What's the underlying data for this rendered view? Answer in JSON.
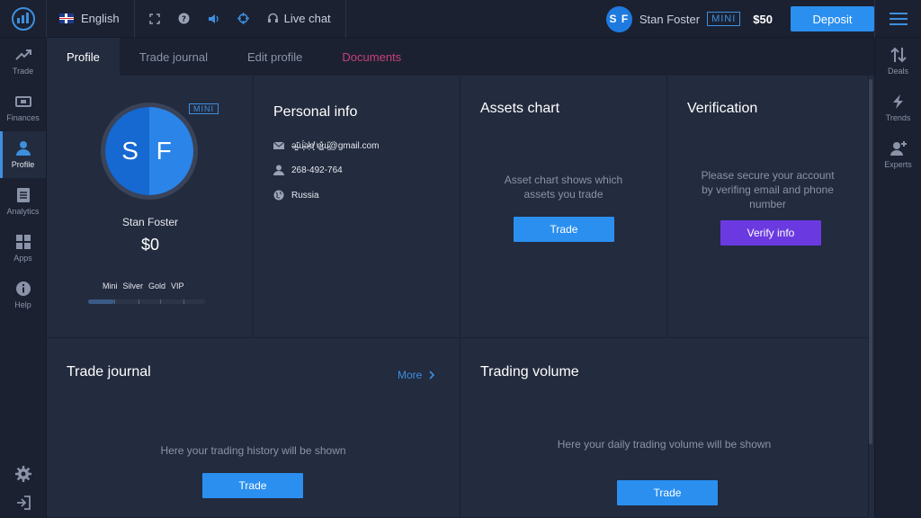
{
  "topbar": {
    "language": "English",
    "live_chat": "Live chat",
    "user_initials": "S F",
    "user_name": "Stan Foster",
    "account_type": "MINI",
    "balance": "$50",
    "deposit_label": "Deposit"
  },
  "left_nav": [
    {
      "label": "Trade",
      "icon": "trend-up-icon"
    },
    {
      "label": "Finances",
      "icon": "wallet-icon"
    },
    {
      "label": "Profile",
      "icon": "user-icon",
      "active": true
    },
    {
      "label": "Analytics",
      "icon": "news-icon"
    },
    {
      "label": "Apps",
      "icon": "grid-icon"
    },
    {
      "label": "Help",
      "icon": "info-icon"
    }
  ],
  "right_nav": [
    {
      "label": "Deals",
      "icon": "sort-arrows-icon"
    },
    {
      "label": "Trends",
      "icon": "lightning-icon"
    },
    {
      "label": "Experts",
      "icon": "user-plus-icon"
    }
  ],
  "tabs": [
    {
      "label": "Profile",
      "active": true
    },
    {
      "label": "Trade journal"
    },
    {
      "label": "Edit profile"
    },
    {
      "label": "Documents"
    }
  ],
  "profile": {
    "initials": "S F",
    "badge": "MINI",
    "name": "Stan Foster",
    "balance": "$0",
    "levels": [
      "Mini",
      "Silver",
      "Gold",
      "VIP"
    ],
    "level_progress": 0.22
  },
  "personal_info": {
    "title": "Personal info",
    "email": "ǝ̶̰͖̃ɯ̴̞̈́ǝ̷̖̓ɐ̸̙͗ ɐ̷͇̽ɯ̵͖̋@gmail.com",
    "phone": "268-492-764",
    "country": "Russia"
  },
  "assets_chart": {
    "title": "Assets chart",
    "message": "Asset chart shows which assets you trade",
    "button": "Trade"
  },
  "verification": {
    "title": "Verification",
    "message": "Please secure your account by verifing email and phone number",
    "button": "Verify info"
  },
  "trade_journal": {
    "title": "Trade journal",
    "more": "More",
    "message": "Here your trading history will be shown",
    "button": "Trade"
  },
  "trading_volume": {
    "title": "Trading volume",
    "message": "Here your daily trading volume will be shown",
    "button": "Trade"
  },
  "colors": {
    "accent": "#2b8ff0",
    "verify": "#6a3ae0",
    "documents_tab": "#c8407a"
  }
}
